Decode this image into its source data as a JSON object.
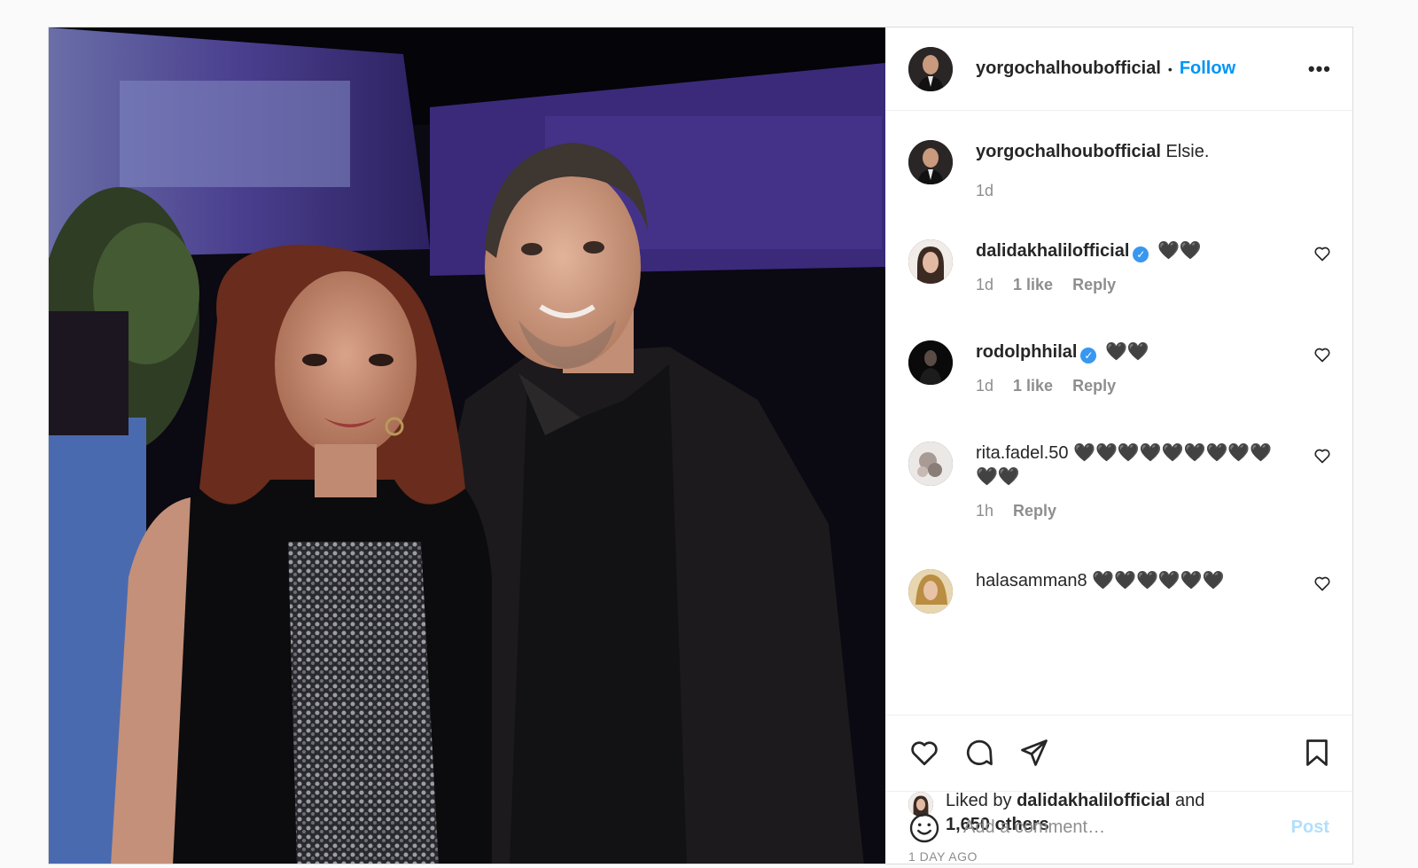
{
  "post": {
    "author": "yorgochalhoubofficial",
    "separator": "•",
    "follow_label": "Follow",
    "more_label": "•••"
  },
  "caption": {
    "username": "yorgochalhoubofficial",
    "text": "Elsie.",
    "time": "1d"
  },
  "comments": [
    {
      "username": "dalidakhalilofficial",
      "verified": true,
      "text": "🖤🖤",
      "time": "1d",
      "likes": "1 like",
      "reply": "Reply"
    },
    {
      "username": "rodolphhilal",
      "verified": true,
      "text": "🖤🖤",
      "time": "1d",
      "likes": "1 like",
      "reply": "Reply"
    },
    {
      "username": "rita.fadel.50",
      "verified": false,
      "text": "🖤🖤🖤🖤🖤🖤🖤🖤🖤🖤🖤",
      "time": "1h",
      "likes": "",
      "reply": "Reply"
    },
    {
      "username": "halasamman8",
      "verified": false,
      "text": "🖤🖤🖤🖤🖤🖤",
      "time": "",
      "likes": "",
      "reply": ""
    }
  ],
  "likes": {
    "prefix": "Liked by",
    "user": "dalidakhalilofficial",
    "and": "and",
    "others": "1,650 others"
  },
  "time_ago": "1 DAY AGO",
  "add_comment": {
    "placeholder": "Add a comment…",
    "post_label": "Post"
  },
  "icons": {
    "like": "heart-icon",
    "comment": "comment-icon",
    "share": "paper-plane-icon",
    "save": "bookmark-icon",
    "emoji": "smiley-icon"
  },
  "colors": {
    "link": "#0095f6",
    "verified": "#3897f0",
    "post_disabled": "#b2dffc",
    "muted": "#8e8e8e"
  }
}
